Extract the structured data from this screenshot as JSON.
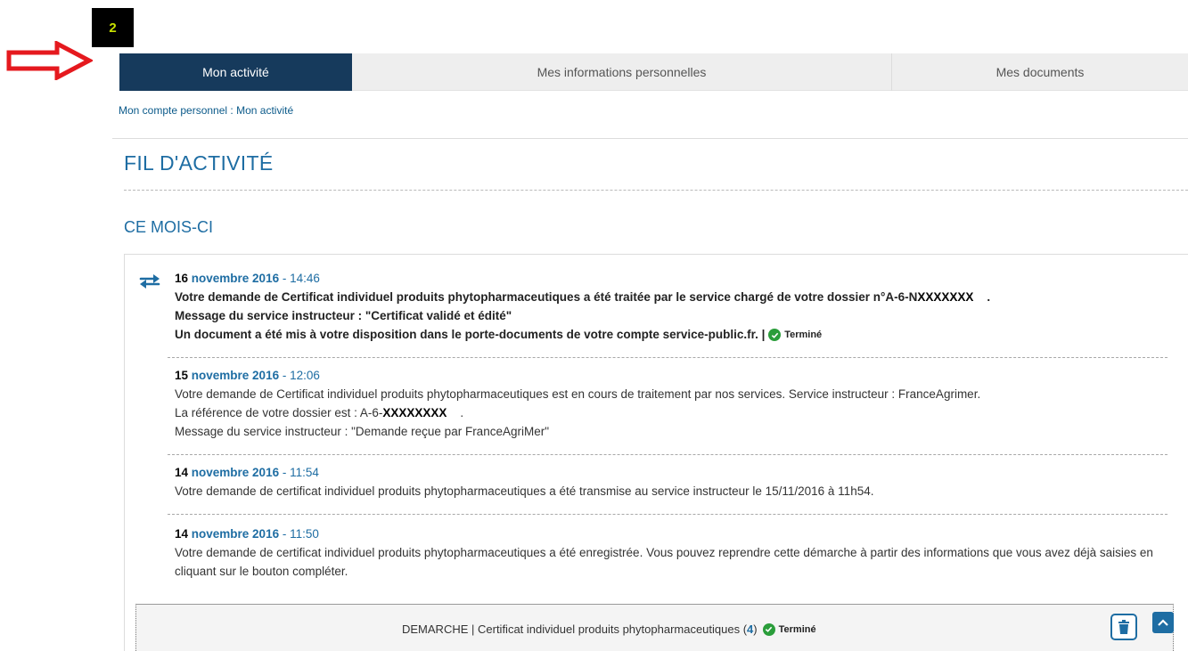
{
  "annotation": {
    "marker_label": "2"
  },
  "tabs": [
    {
      "label": "Mon activité",
      "active": true
    },
    {
      "label": "Mes informations personnelles",
      "active": false
    },
    {
      "label": "Mes documents",
      "active": false
    }
  ],
  "breadcrumb": {
    "root": "Mon compte personnel",
    "separator": " : ",
    "current": "Mon activité"
  },
  "page_title": "FIL D'ACTIVITÉ",
  "section_title": "CE MOIS-CI",
  "entries": [
    {
      "day": "16",
      "date_rest": " novembre 2016",
      "time": " - 14:46",
      "line1": "Votre demande de Certificat individuel produits phytopharmaceutiques a été traitée par le service chargé de votre dossier n°A-6-N",
      "ref": "XXXXXXX",
      "ref_suffix": "    .",
      "line2": "Message du service instructeur : \"Certificat validé et édité\"",
      "line3": "Un document a été mis à votre disposition dans le porte-documents de votre compte service-public.fr. | ",
      "status": "Terminé"
    },
    {
      "day": "15",
      "date_rest": " novembre 2016",
      "time": " - 12:06",
      "line1": "Votre demande de Certificat individuel produits phytopharmaceutiques est en cours de traitement par nos services. Service instructeur : FranceAgrimer.",
      "line2_prefix": "La référence de votre dossier est : A-6-",
      "ref": "XXXXXXXX",
      "ref_suffix": "    .",
      "line3": "Message du service instructeur : \"Demande reçue par FranceAgriMer\""
    },
    {
      "day": "14",
      "date_rest": " novembre 2016",
      "time": " - 11:54",
      "line1": "Votre demande de certificat individuel produits phytopharmaceutiques a été transmise au service instructeur le 15/11/2016 à 11h54."
    },
    {
      "day": "14",
      "date_rest": " novembre 2016",
      "time": " - 11:50",
      "line1": "Votre demande de certificat individuel produits phytopharmaceutiques a été enregistrée. Vous pouvez reprendre cette démarche à partir des informations que vous avez déjà saisies en cliquant sur le bouton compléter."
    }
  ],
  "footer": {
    "prefix": "DEMARCHE | Certificat individuel produits phytopharmaceutiques (",
    "count": "4",
    "suffix": ")",
    "status": "Terminé"
  },
  "icons": {
    "swap": "swap-arrows-icon",
    "check": "check-circle-icon",
    "trash": "trash-icon",
    "chevron": "chevron-up-icon",
    "arrow": "red-arrow-icon"
  },
  "colors": {
    "tab_active": "#163a5c",
    "accent": "#1e6da3",
    "status_green": "#2a9d3a",
    "marker_bg": "#000000",
    "marker_text": "#c7e000",
    "arrow_red": "#e5191e"
  }
}
